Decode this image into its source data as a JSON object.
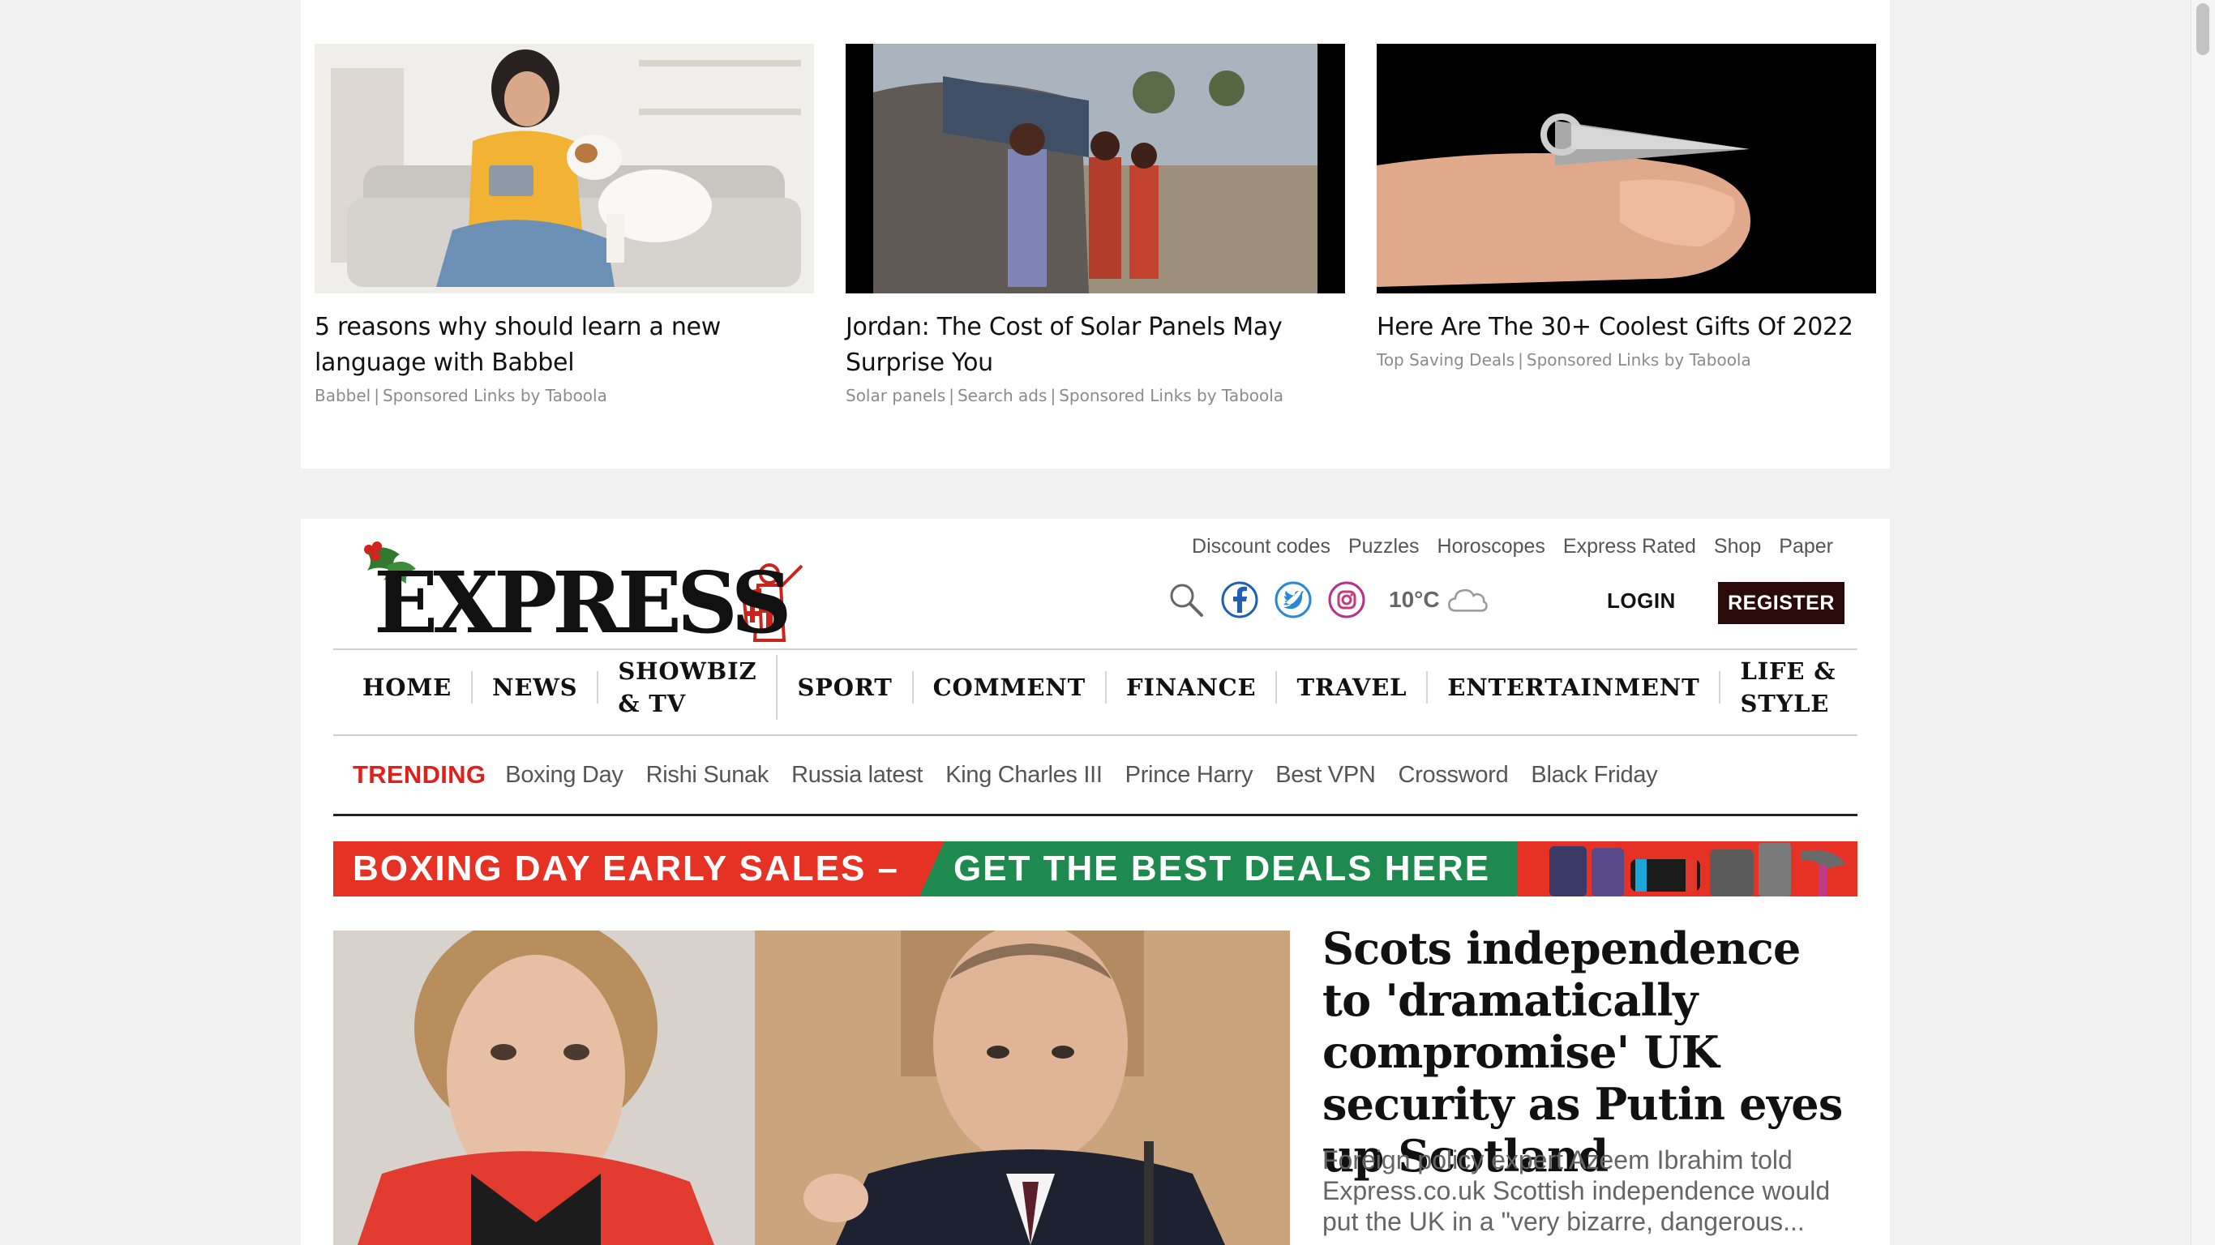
{
  "taboola": {
    "cards": [
      {
        "title": "5 reasons why should learn a new language with Babbel",
        "source": "Babbel",
        "sponsor": "Sponsored Links by Taboola",
        "image_desc": "woman with tablet and dog"
      },
      {
        "title": "Jordan: The Cost of Solar Panels May Surprise You",
        "source": "Solar panels",
        "source2": "Search ads",
        "sponsor": "Sponsored Links by Taboola",
        "image_desc": "people by solar panels on hut"
      },
      {
        "title": "Here Are The 30+ Coolest Gifts Of 2022",
        "source": "Top Saving Deals",
        "sponsor": "Sponsored Links by Taboola",
        "image_desc": "tiny metal gadget on fingertip"
      }
    ],
    "separator": "|"
  },
  "header": {
    "logo_text": "EXPRESS",
    "utility_links": [
      "Discount codes",
      "Puzzles",
      "Horoscopes",
      "Express Rated",
      "Shop",
      "Paper"
    ],
    "temperature": "10°C",
    "weather_icon": "cloud-icon",
    "login_label": "LOGIN",
    "register_label": "REGISTER",
    "social_icons": [
      "facebook-icon",
      "twitter-icon",
      "instagram-icon"
    ],
    "colors": {
      "register_bg": "#2b0a0a",
      "trending": "#e0201b"
    }
  },
  "nav": {
    "items": [
      "HOME",
      "NEWS",
      "SHOWBIZ & TV",
      "SPORT",
      "COMMENT",
      "FINANCE",
      "TRAVEL",
      "ENTERTAINMENT",
      "LIFE & STYLE"
    ]
  },
  "trending": {
    "label": "TRENDING",
    "items": [
      "Boxing Day",
      "Rishi Sunak",
      "Russia latest",
      "King Charles III",
      "Prince Harry",
      "Best VPN",
      "Crossword",
      "Black Friday"
    ]
  },
  "banner": {
    "part1": "BOXING DAY EARLY SALES –",
    "part2": "GET THE BEST DEALS HERE",
    "colors": {
      "red": "#e53224",
      "green": "#1e8a4f"
    }
  },
  "lead_story": {
    "headline": "Scots independence to 'dramatically compromise' UK security as Putin eyes up Scotland",
    "standfirst": "Foreign policy expert Azeem Ibrahim told Express.co.uk Scottish independence would put the UK in a \"very bizarre, dangerous..."
  }
}
